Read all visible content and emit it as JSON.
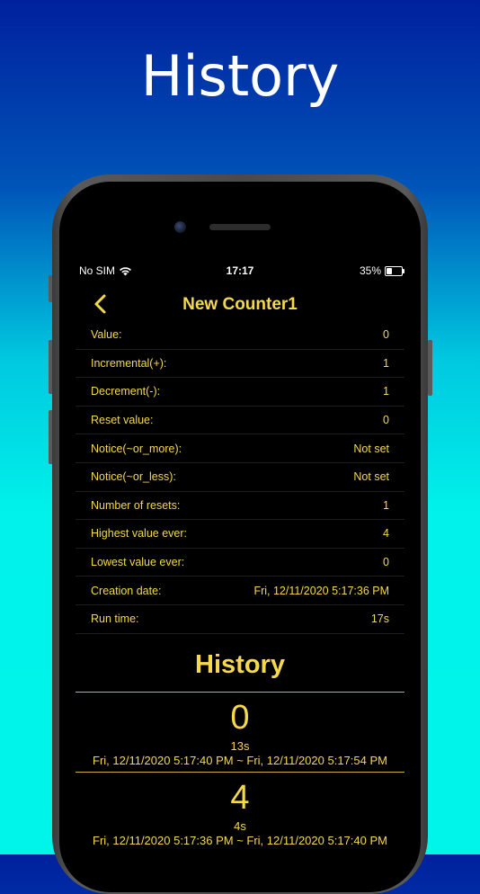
{
  "promo": {
    "title": "History"
  },
  "status": {
    "carrier": "No SIM",
    "time": "17:17",
    "battery": "35%",
    "battery_level": 0.35
  },
  "nav": {
    "title": "New Counter1"
  },
  "details": [
    {
      "label": "Value:",
      "value": "0"
    },
    {
      "label": "Incremental(+):",
      "value": "1"
    },
    {
      "label": "Decrement(-):",
      "value": "1"
    },
    {
      "label": "Reset value:",
      "value": "0"
    },
    {
      "label": "Notice(~or_more):",
      "value": "Not set"
    },
    {
      "label": "Notice(~or_less):",
      "value": "Not set"
    },
    {
      "label": "Number of resets:",
      "value": "1"
    },
    {
      "label": "Highest value ever:",
      "value": "4"
    },
    {
      "label": "Lowest value ever:",
      "value": "0"
    },
    {
      "label": "Creation date:",
      "value": "Fri, 12/11/2020 5:17:36 PM"
    },
    {
      "label": "Run time:",
      "value": "17s"
    }
  ],
  "history": {
    "title": "History",
    "entries": [
      {
        "value": "0",
        "duration": "13s",
        "range": "Fri, 12/11/2020 5:17:40 PM ~ Fri, 12/11/2020 5:17:54 PM"
      },
      {
        "value": "4",
        "duration": "4s",
        "range": "Fri, 12/11/2020 5:17:36 PM ~ Fri, 12/11/2020 5:17:40 PM"
      }
    ]
  },
  "colors": {
    "accent": "#f5d94b",
    "screen_bg": "#000000",
    "gradient_top": "#00209e",
    "gradient_bottom": "#00f5ea"
  }
}
